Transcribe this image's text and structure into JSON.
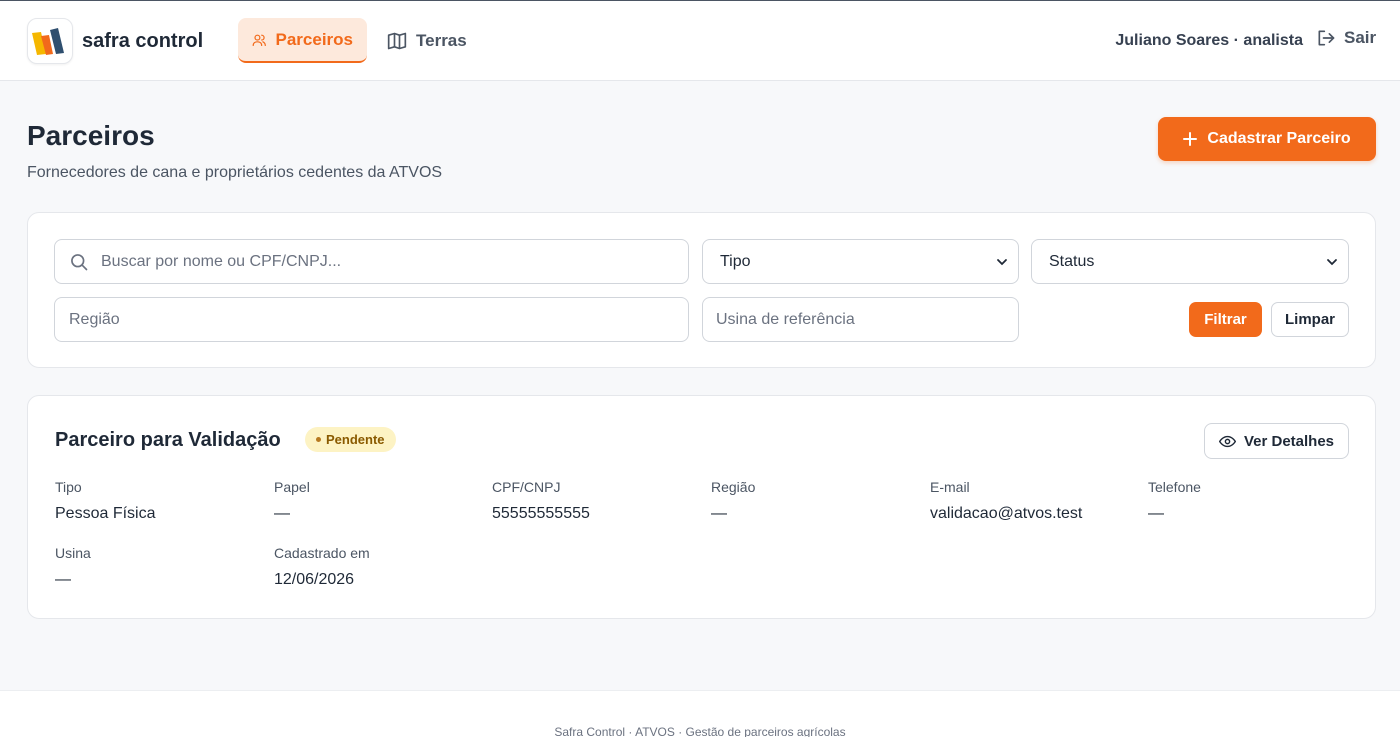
{
  "header": {
    "brand": "safra control",
    "nav": [
      {
        "label": "Parceiros",
        "icon": "users-icon",
        "active": true
      },
      {
        "label": "Terras",
        "icon": "map-icon",
        "active": false
      }
    ],
    "user": "Juliano Soares · analista",
    "logout_label": "Sair"
  },
  "page": {
    "title": "Parceiros",
    "subtitle": "Fornecedores de cana e proprietários cedentes da ATVOS",
    "add_button": "Cadastrar Parceiro"
  },
  "filters": {
    "search_placeholder": "Buscar por nome ou CPF/CNPJ...",
    "tipo_label": "Tipo",
    "status_label": "Status",
    "regiao_placeholder": "Região",
    "usina_placeholder": "Usina de referência",
    "filter_button": "Filtrar",
    "clear_button": "Limpar"
  },
  "partner": {
    "name": "Parceiro para Validação",
    "status": "Pendente",
    "details_button": "Ver Detalhes",
    "fields": [
      {
        "label": "Tipo",
        "value": "Pessoa Física"
      },
      {
        "label": "Papel",
        "value": "—"
      },
      {
        "label": "CPF/CNPJ",
        "value": "55555555555"
      },
      {
        "label": "Região",
        "value": "—"
      },
      {
        "label": "E-mail",
        "value": "validacao@atvos.test"
      },
      {
        "label": "Telefone",
        "value": "—"
      },
      {
        "label": "Usina",
        "value": "—"
      },
      {
        "label": "Cadastrado em",
        "value": "12/06/2026"
      }
    ]
  },
  "footer": {
    "text": "Safra Control · ATVOS · Gestão de parceiros agrícolas"
  },
  "colors": {
    "accent": "#f26a1b",
    "accent_soft": "#fde9dc",
    "badge_bg": "#fdf3c4",
    "badge_text": "#8a5a00"
  }
}
